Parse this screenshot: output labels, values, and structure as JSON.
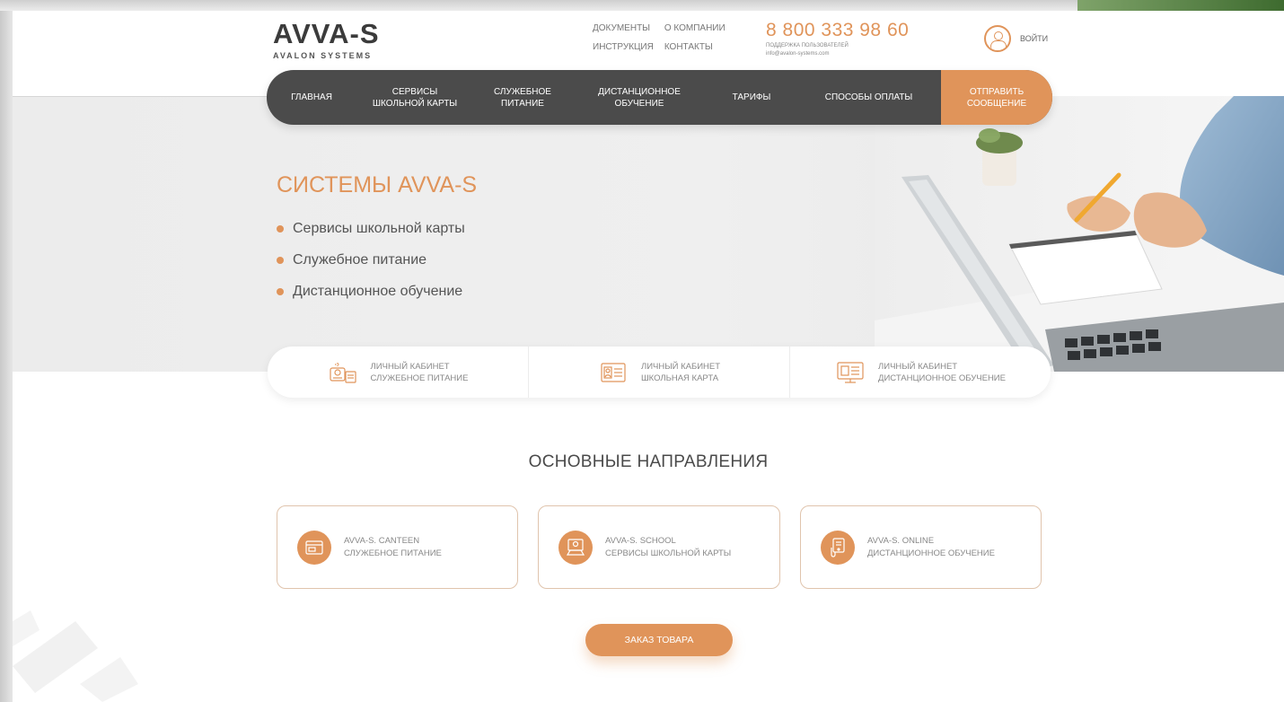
{
  "brand": {
    "logo_mark": "AVVA-S",
    "logo_sub": "AVALON SYSTEMS"
  },
  "toplinks": [
    "ДОКУМЕНТЫ",
    "О КОМПАНИИ",
    "ИНСТРУКЦИЯ",
    "КОНТАКТЫ"
  ],
  "phone": {
    "number": "8 800 333 98 60",
    "support": "ПОДДЕРЖКА ПОЛЬЗОВАТЕЛЕЙ",
    "email": "info@avalon-systems.com"
  },
  "login": {
    "label": "ВОЙТИ"
  },
  "nav": {
    "items": [
      {
        "l1": "ГЛАВНАЯ",
        "l2": ""
      },
      {
        "l1": "СЕРВИСЫ",
        "l2": "ШКОЛЬНОЙ КАРТЫ"
      },
      {
        "l1": "СЛУЖЕБНОЕ",
        "l2": "ПИТАНИЕ"
      },
      {
        "l1": "ДИСТАНЦИОННОЕ",
        "l2": "ОБУЧЕНИЕ"
      },
      {
        "l1": "ТАРИФЫ",
        "l2": ""
      },
      {
        "l1": "СПОСОБЫ ОПЛАТЫ",
        "l2": ""
      }
    ],
    "cta": {
      "l1": "ОТПРАВИТЬ",
      "l2": "СООБЩЕНИЕ"
    }
  },
  "hero": {
    "title": "СИСТЕМЫ AVVA-S",
    "items": [
      "Сервисы школьной карты",
      "Служебное питание",
      "Дистанционное обучение"
    ]
  },
  "cabinets": [
    {
      "l1": "ЛИЧНЫЙ КАБИНЕТ",
      "l2": "СЛУЖЕБНОЕ ПИТАНИЕ",
      "icon": "canteen-icon"
    },
    {
      "l1": "ЛИЧНЫЙ КАБИНЕТ",
      "l2": "ШКОЛЬНАЯ КАРТА",
      "icon": "id-card-icon"
    },
    {
      "l1": "ЛИЧНЫЙ КАБИНЕТ",
      "l2": "ДИСТАНЦИОННОЕ ОБУЧЕНИЕ",
      "icon": "monitor-icon"
    }
  ],
  "directions": {
    "title": "ОСНОВНЫЕ НАПРАВЛЕНИЯ",
    "cards": [
      {
        "l1": "AVVA-S. CANTEEN",
        "l2": "СЛУЖЕБНОЕ ПИТАНИЕ",
        "icon": "card-terminal-icon"
      },
      {
        "l1": "AVVA-S. SCHOOL",
        "l2": "СЕРВИСЫ ШКОЛЬНОЙ КАРТЫ",
        "icon": "school-card-icon"
      },
      {
        "l1": "AVVA-S. ONLINE",
        "l2": "ДИСТАНЦИОННОЕ ОБУЧЕНИЕ",
        "icon": "online-device-icon"
      }
    ]
  },
  "order_button": "ЗАКАЗ ТОВАРА",
  "colors": {
    "accent": "#e0945a",
    "nav_bg": "#4b4b4b",
    "text": "#555555"
  }
}
